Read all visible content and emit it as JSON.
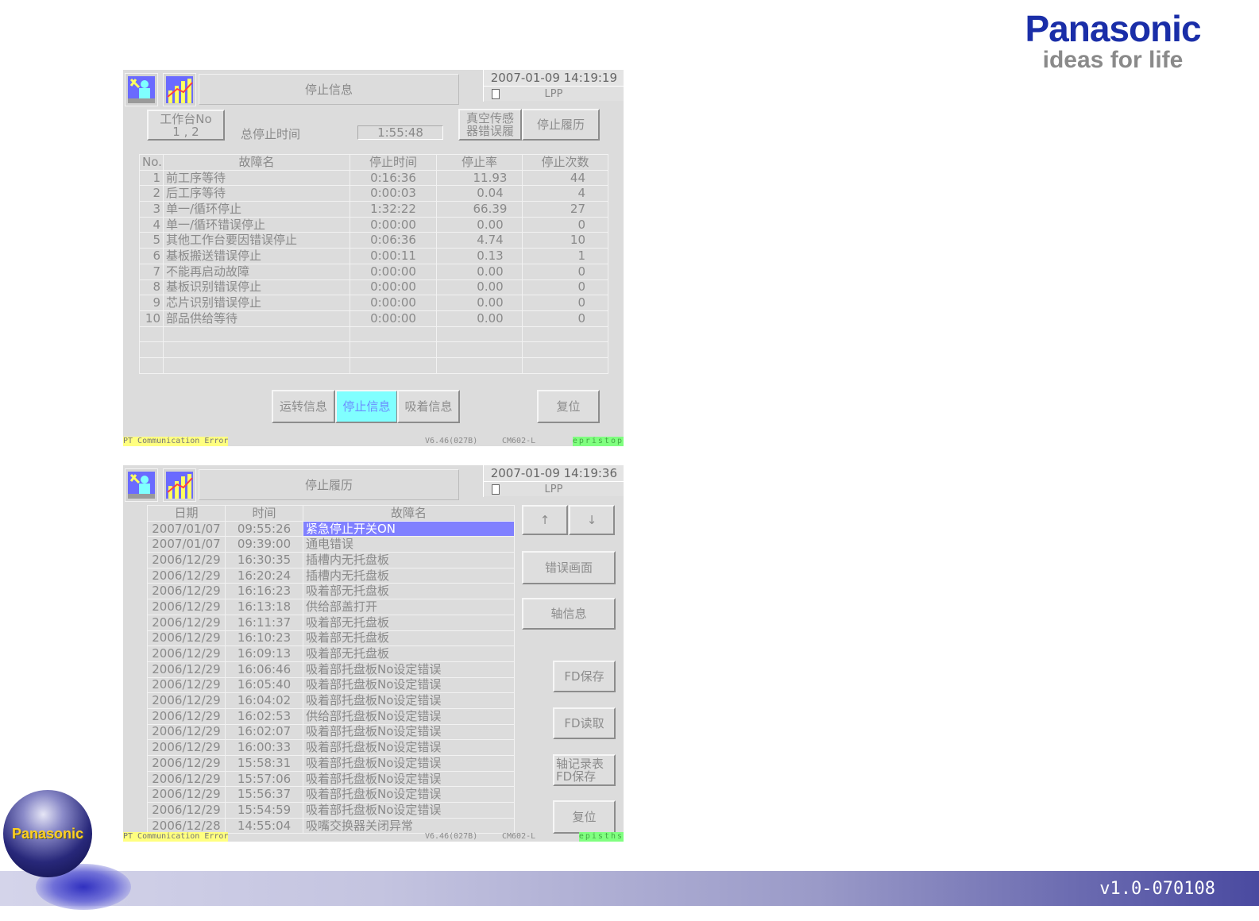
{
  "brand": {
    "logo": "Panasonic",
    "tagline": "ideas for life",
    "globe_logo": "Panasonic",
    "version": "v1.0-070108"
  },
  "panel1": {
    "title": "停止信息",
    "date": "2007-01-09  14:19:19",
    "line": "LPP",
    "table_btn": "工作台No\n1 , 2",
    "total_label": "总停止时间",
    "total_value": "1:55:48",
    "vacuum_btn": "真空传感\n器错误履",
    "history_btn": "停止履历",
    "headers": [
      "No.",
      "故障名",
      "停止时间",
      "停止率",
      "停止次数"
    ],
    "rows": [
      [
        "1",
        "前工序等待",
        "0:16:36",
        "11.93",
        "44"
      ],
      [
        "2",
        "后工序等待",
        "0:00:03",
        "0.04",
        "4"
      ],
      [
        "3",
        "单一/循环停止",
        "1:32:22",
        "66.39",
        "27"
      ],
      [
        "4",
        "单一/循环错误停止",
        "0:00:00",
        "0.00",
        "0"
      ],
      [
        "5",
        "其他工作台要因错误停止",
        "0:06:36",
        "4.74",
        "10"
      ],
      [
        "6",
        "基板搬送错误停止",
        "0:00:11",
        "0.13",
        "1"
      ],
      [
        "7",
        "不能再启动故障",
        "0:00:00",
        "0.00",
        "0"
      ],
      [
        "8",
        "基板识别错误停止",
        "0:00:00",
        "0.00",
        "0"
      ],
      [
        "9",
        "芯片识别错误停止",
        "0:00:00",
        "0.00",
        "0"
      ],
      [
        "10",
        "部品供给等待",
        "0:00:00",
        "0.00",
        "0"
      ]
    ],
    "tabs": [
      "运转信息",
      "停止信息",
      "吸着信息"
    ],
    "reset": "复位",
    "status": {
      "error": "PT Communication Error",
      "version": "V6.46(027B)",
      "model": "CM602-L",
      "mode": "epristop"
    }
  },
  "panel2": {
    "title": "停止履历",
    "date": "2007-01-09  14:19:36",
    "line": "LPP",
    "headers": [
      "日期",
      "时间",
      "故障名"
    ],
    "rows": [
      [
        "2007/01/07",
        "09:55:26",
        "紧急停止开关ON"
      ],
      [
        "2007/01/07",
        "09:39:00",
        "通电错误"
      ],
      [
        "2006/12/29",
        "16:30:35",
        "插槽内无托盘板"
      ],
      [
        "2006/12/29",
        "16:20:24",
        "插槽内无托盘板"
      ],
      [
        "2006/12/29",
        "16:16:23",
        "吸着部无托盘板"
      ],
      [
        "2006/12/29",
        "16:13:18",
        "供给部盖打开"
      ],
      [
        "2006/12/29",
        "16:11:37",
        "吸着部无托盘板"
      ],
      [
        "2006/12/29",
        "16:10:23",
        "吸着部无托盘板"
      ],
      [
        "2006/12/29",
        "16:09:13",
        "吸着部无托盘板"
      ],
      [
        "2006/12/29",
        "16:06:46",
        "吸着部托盘板No设定错误"
      ],
      [
        "2006/12/29",
        "16:05:40",
        "吸着部托盘板No设定错误"
      ],
      [
        "2006/12/29",
        "16:04:02",
        "吸着部托盘板No设定错误"
      ],
      [
        "2006/12/29",
        "16:02:53",
        "供给部托盘板No设定错误"
      ],
      [
        "2006/12/29",
        "16:02:07",
        "吸着部托盘板No设定错误"
      ],
      [
        "2006/12/29",
        "16:00:33",
        "吸着部托盘板No设定错误"
      ],
      [
        "2006/12/29",
        "15:58:31",
        "吸着部托盘板No设定错误"
      ],
      [
        "2006/12/29",
        "15:57:06",
        "吸着部托盘板No设定错误"
      ],
      [
        "2006/12/29",
        "15:56:37",
        "吸着部托盘板No设定错误"
      ],
      [
        "2006/12/29",
        "15:54:59",
        "吸着部托盘板No设定错误"
      ],
      [
        "2006/12/28",
        "14:55:04",
        "吸嘴交换器关闭异常"
      ]
    ],
    "up": "↑",
    "down": "↓",
    "error_screen": "错误画面",
    "axis_info": "轴信息",
    "fd_save": "FD保存",
    "fd_read": "FD读取",
    "axis_log": "轴记录表\nFD保存",
    "reset": "复位",
    "status": {
      "error": "PT Communication Error",
      "version": "V6.46(027B)",
      "model": "CM602-L",
      "mode": "episths"
    }
  }
}
